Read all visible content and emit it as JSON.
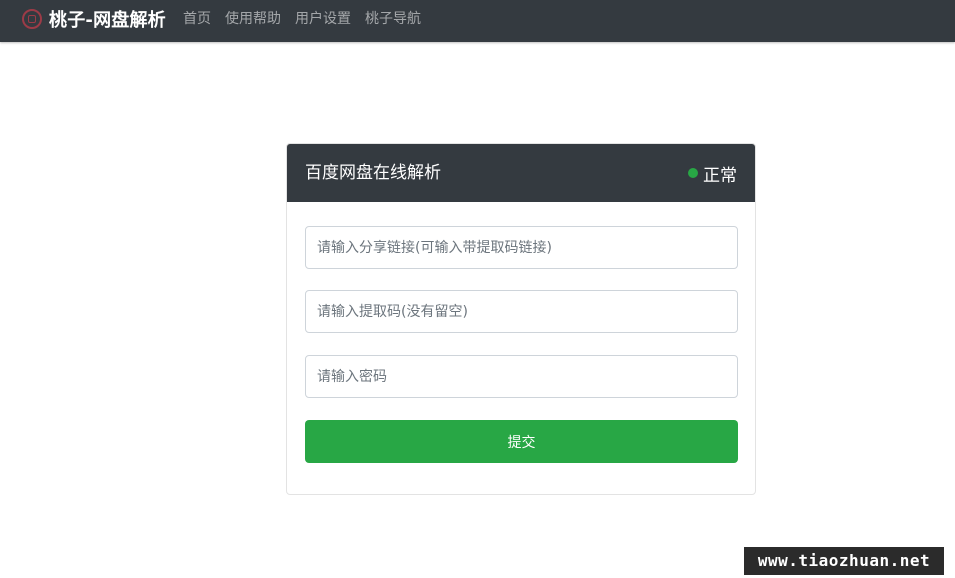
{
  "navbar": {
    "brand_text": "桃子-网盘解析",
    "brand_icon": "peach-seal-icon",
    "links": [
      {
        "label": "首页"
      },
      {
        "label": "使用帮助"
      },
      {
        "label": "用户设置"
      },
      {
        "label": "桃子导航"
      }
    ]
  },
  "card": {
    "title": "百度网盘在线解析",
    "status_label": "正常",
    "status_color": "#28a745",
    "share_link_placeholder": "请输入分享链接(可输入带提取码链接)",
    "share_link_value": "",
    "extract_code_placeholder": "请输入提取码(没有留空)",
    "extract_code_value": "",
    "password_placeholder": "请输入密码",
    "password_value": "",
    "submit_label": "提交",
    "submit_color": "#28a745"
  },
  "watermark": {
    "text": "www.tiaozhuan.net"
  },
  "colors": {
    "dark": "#343a40",
    "accent": "#28a745"
  }
}
